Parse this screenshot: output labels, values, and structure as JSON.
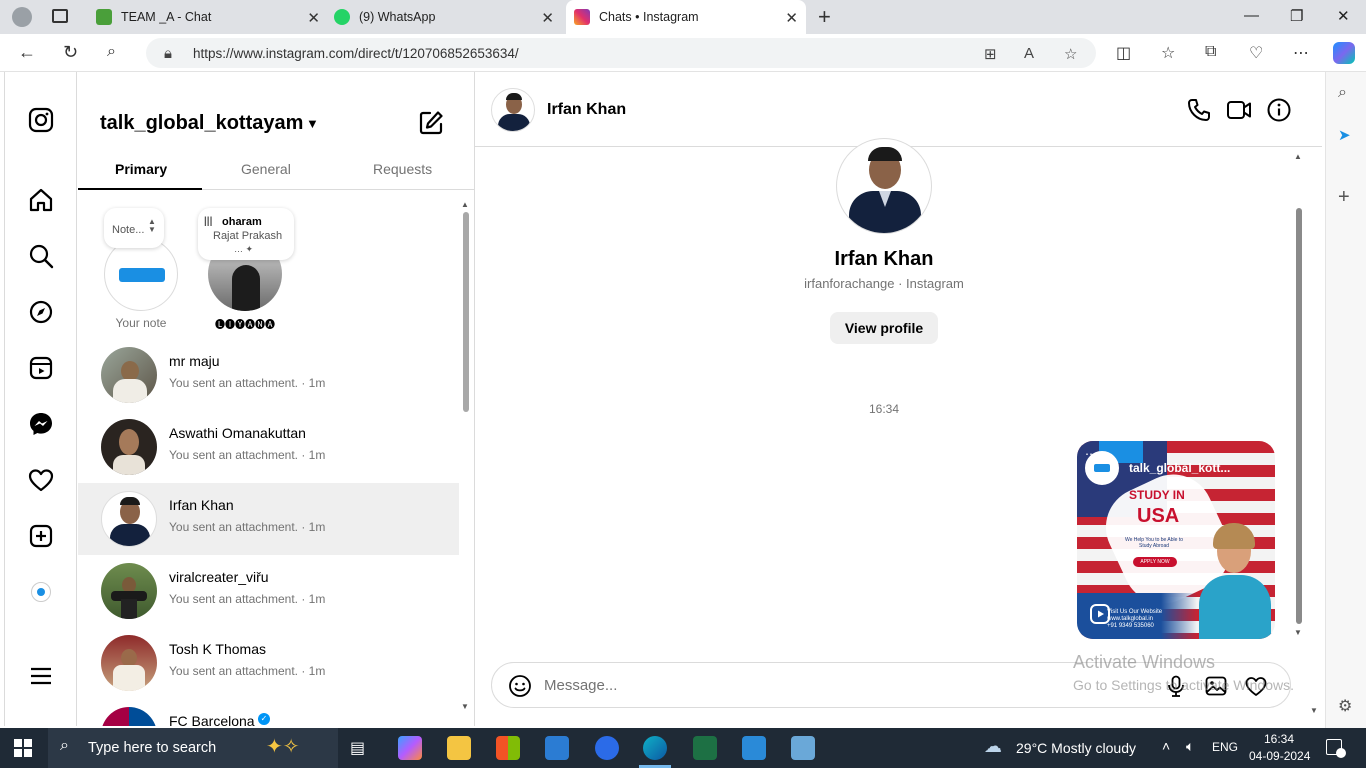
{
  "browser": {
    "tabs": [
      {
        "title": "TEAM _A - Chat",
        "color": "#4a9f3a"
      },
      {
        "title": "(9) WhatsApp",
        "color": "#25d366"
      },
      {
        "title": "Chats • Instagram",
        "color": "#e1306c"
      }
    ],
    "url": "https://www.instagram.com/direct/t/120706852653634/"
  },
  "inbox": {
    "account": "talk_global_kottayam",
    "tabs": [
      "Primary",
      "General",
      "Requests"
    ],
    "notes": [
      {
        "bubble": "Note...",
        "label": "Your note"
      },
      {
        "bubble_title": "oharam",
        "bubble_sub": "Rajat Prakash",
        "label": "🅛🅘🅨🅐🅝🅐"
      }
    ],
    "chats": [
      {
        "name": "mr maju",
        "sub": "You sent an attachment. · 1m"
      },
      {
        "name": "Aswathi Omanakuttan",
        "sub": "You sent an attachment. · 1m"
      },
      {
        "name": "Irfan Khan",
        "sub": "You sent an attachment. · 1m"
      },
      {
        "name": "viralcreater_viřu",
        "sub": "You sent an attachment. · 1m"
      },
      {
        "name": "Tosh K Thomas",
        "sub": "You sent an attachment. · 1m"
      },
      {
        "name": "FC Barcelona",
        "sub": ""
      }
    ]
  },
  "conversation": {
    "name": "Irfan Khan",
    "profile_name": "Irfan Khan",
    "profile_sub": "irfanforachange · Instagram",
    "view_profile": "View profile",
    "timestamp": "16:34",
    "attachment": {
      "user": "talk_global_kott...",
      "headline": "STUDY IN",
      "country": "USA",
      "tagline": "We Help You to be Able to Study Abroad",
      "cta": "APPLY NOW",
      "website": "Visit Us Our Website www.talkglobal.in",
      "phone": "+91 9349 535060"
    },
    "composer_placeholder": "Message..."
  },
  "watermark": {
    "line1": "Activate Windows",
    "line2": "Go to Settings to activate Windows."
  },
  "taskbar": {
    "search_text": "Type here to search",
    "weather": "29°C  Mostly cloudy",
    "lang": "ENG",
    "time": "16:34",
    "date": "04-09-2024"
  }
}
